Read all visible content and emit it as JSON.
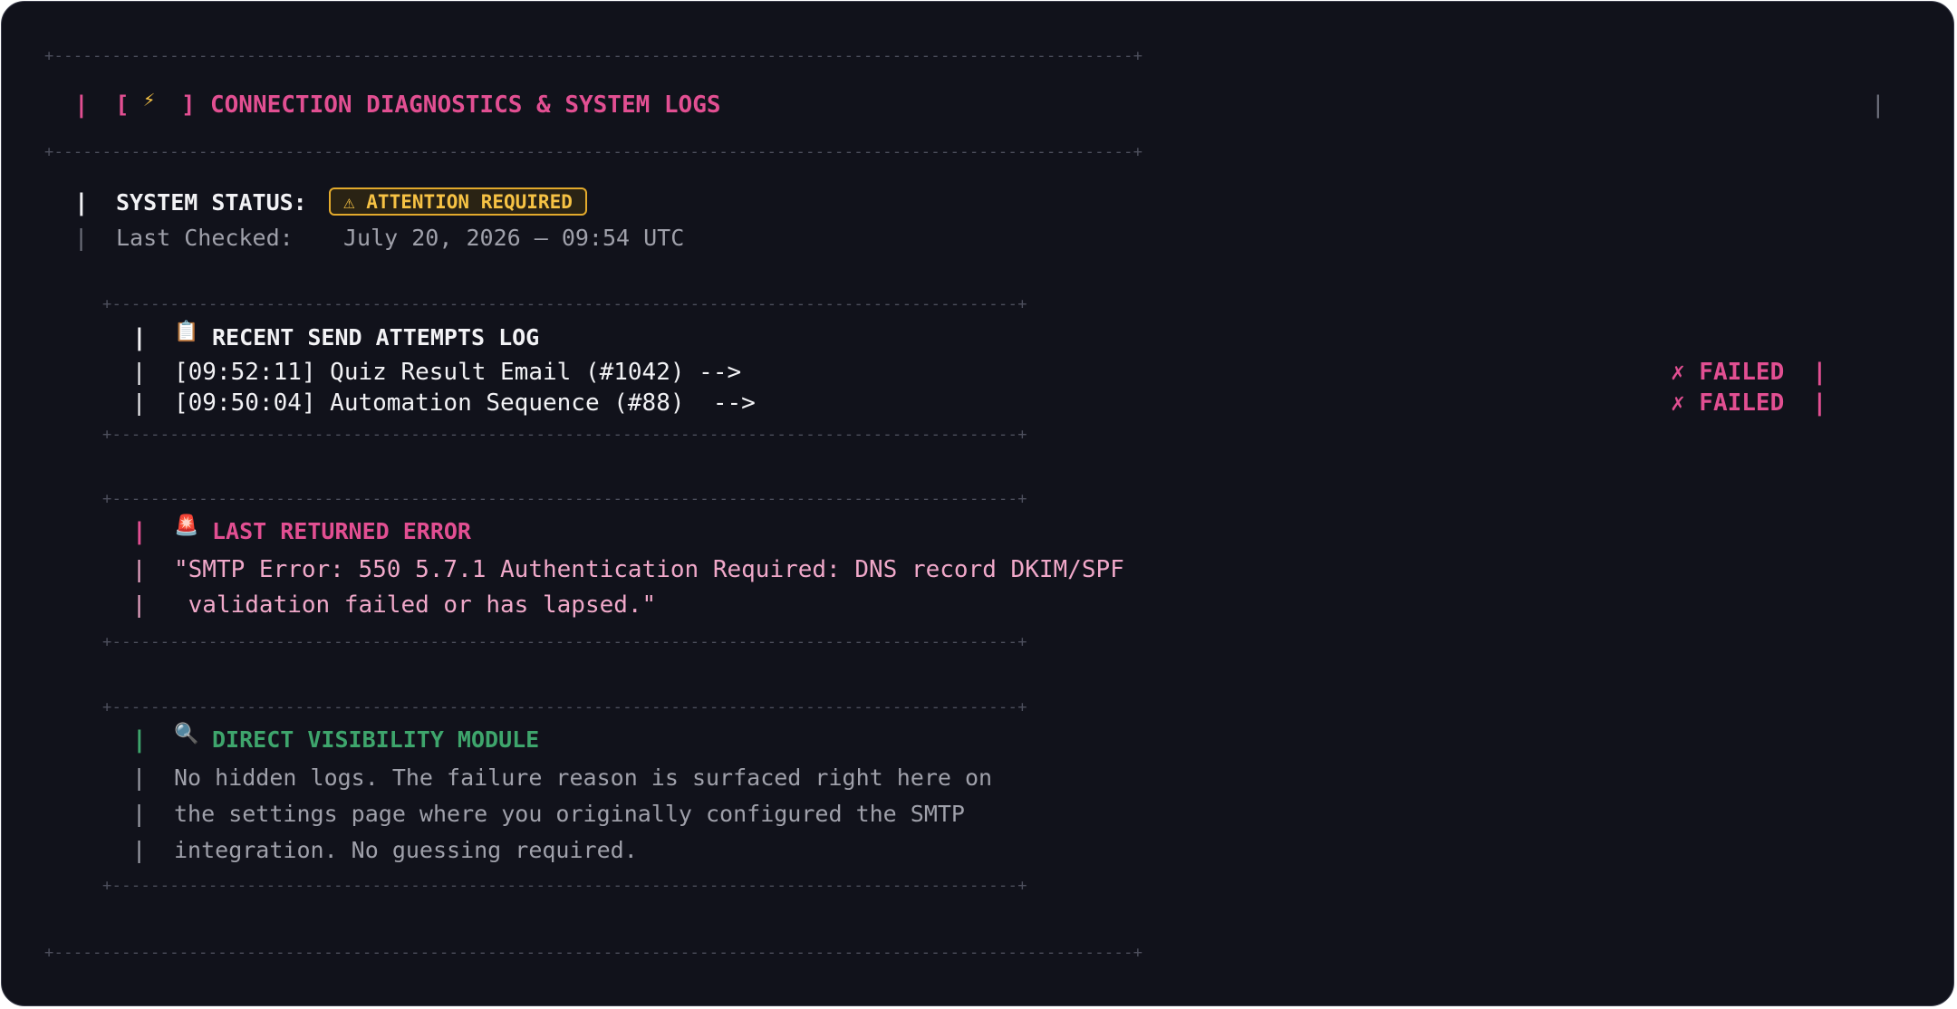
{
  "header": {
    "border": "+----------------------------------------------------------------------------------------------------------------+",
    "left_pipe": "|",
    "bracket_open": "[",
    "bracket_close": "]",
    "title": "CONNECTION DIAGNOSTICS & SYSTEM LOGS",
    "right_pipe": "|",
    "icon": "lightning-icon"
  },
  "status": {
    "pipe": "|",
    "label": "SYSTEM STATUS:",
    "badge_text": "⚠ ATTENTION REQUIRED",
    "checked_label": "Last Checked:",
    "checked_value": "July 20, 2026 – 09:54 UTC"
  },
  "send_log": {
    "border": "+----------------------------------------------------------------------------------------------+",
    "title": "RECENT SEND ATTEMPTS LOG",
    "icon": "clipboard-icon",
    "pipe": "|",
    "entries": [
      {
        "text": "[09:52:11] Quiz Result Email (#1042) -->",
        "status": "✗ FAILED  |"
      },
      {
        "text": "[09:50:04] Automation Sequence (#88)  -->",
        "status": "✗ FAILED  |"
      }
    ]
  },
  "error": {
    "title": "LAST RETURNED ERROR",
    "icon": "siren-icon",
    "pipe": "|",
    "line1": "\"SMTP Error: 550 5.7.1 Authentication Required: DNS record DKIM/SPF",
    "line2": " validation failed or has lapsed.\""
  },
  "visibility": {
    "title": "DIRECT VISIBILITY MODULE",
    "icon": "magnifier-icon",
    "pipe": "|",
    "lines": [
      "No hidden logs. The failure reason is surfaced right here on",
      "the settings page where you originally configured the SMTP",
      "integration. No guessing required."
    ]
  },
  "colors": {
    "background": "#11121b",
    "accent_pink": "#e24f92",
    "warning_amber": "#f6c244",
    "success_green": "#3ea56c"
  }
}
